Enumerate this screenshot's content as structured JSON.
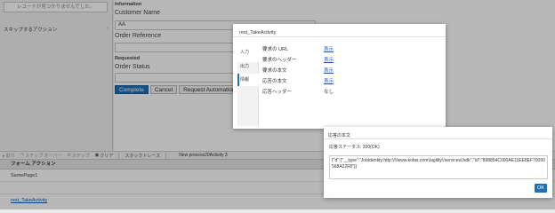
{
  "left_panel": {
    "no_records": "レコードが見つかりませんでした。",
    "skip_action": "スキップするアクション",
    "chevron": "›"
  },
  "form": {
    "information_head": "Information",
    "customer_name_label": "Customer Name",
    "customer_name_value": "AA",
    "order_reference_label": "Order Reference",
    "order_reference_value": "",
    "requested_head": "Requested",
    "order_status_label": "Order Status",
    "order_status_value": "",
    "buttons": {
      "complete": "Complete",
      "cancel": "Cancel",
      "request_automation": "Request Automation R"
    }
  },
  "debug_bar": {
    "step_in": "▸ 取り",
    "step_over": "ステップ オーバー",
    "step_label": "ステップ",
    "clear": "クリア",
    "stack_trace": "スタックトレース",
    "process": "New process20Activity 3"
  },
  "form_actions": {
    "heading": "フォーム アクション",
    "rows": [
      "SamePage1",
      "",
      "rest_TakeActivity"
    ]
  },
  "activity_modal": {
    "title": "rest_TakeActivity",
    "tabs": [
      "入力",
      "出力",
      "情報"
    ],
    "active_tab": "情報",
    "properties": [
      {
        "key": "要求の URL",
        "value": "表示",
        "link": true
      },
      {
        "key": "要求のヘッダー",
        "value": "表示",
        "link": true
      },
      {
        "key": "要求の本文",
        "value": "表示",
        "link": true
      },
      {
        "key": "応答の本文",
        "value": "表示",
        "link": true
      },
      {
        "key": "応答ヘッダー",
        "value": "なし",
        "link": false
      }
    ]
  },
  "response_modal": {
    "title": "応答の本文",
    "status": "応答ステータス: 200(OK)",
    "body": "{\"d\":{\"__type\":\"JobIdentity:http:\\/\\/www.kofax.com\\/agility\\/services\\/sdk\",\"Id\":\"898854C000AE11EE8EF70050568A22F8\"}}",
    "ok_label": "OK"
  },
  "colors": {
    "primary": "#1f6fb5",
    "link": "#1a57b5"
  }
}
